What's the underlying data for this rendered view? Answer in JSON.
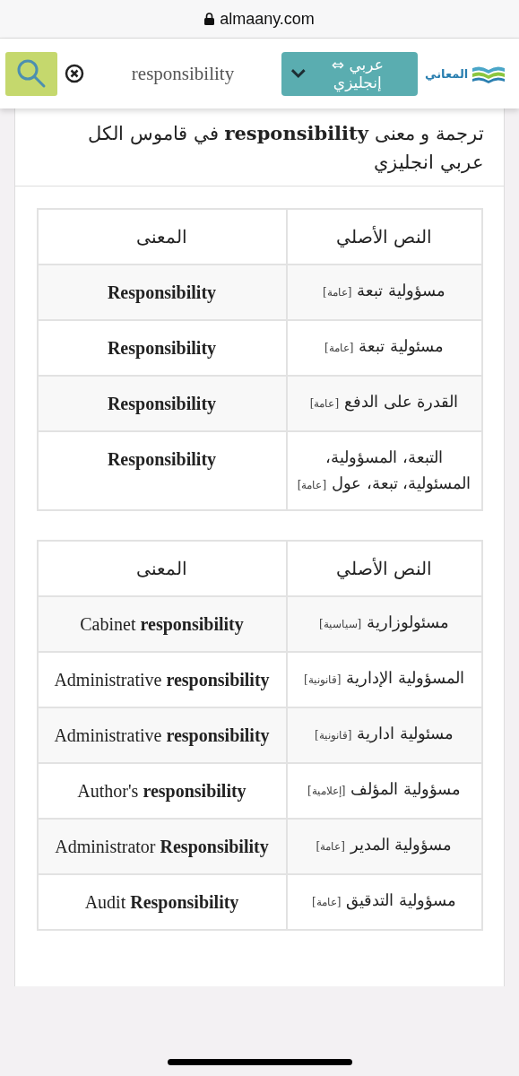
{
  "browser": {
    "url": "almaany.com"
  },
  "header": {
    "search_query": "responsibility",
    "language": "عربي ⇔ إنجليزي",
    "logo": "المعاني"
  },
  "title": "ترجمة و معنى **responsibility** في قاموس الكل عربي انجليزي",
  "tables": [
    {
      "columns": [
        "النص الأصلي",
        "المعنى"
      ],
      "rows": [
        {
          "original": "مسؤولية تبعة",
          "tag": "[عامة]",
          "meaning": "Responsibility",
          "bold": true
        },
        {
          "original": "مسئولية تبعة",
          "tag": "[عامة]",
          "meaning": "Responsibility",
          "bold": true
        },
        {
          "original": "القدرة على الدفع",
          "tag": "[عامة]",
          "meaning": "Responsibility",
          "bold": true
        },
        {
          "original": "التبعة، المسؤولية، المسئولية، تبعة، عول",
          "tag": "[عامة]",
          "meaning": "Responsibility",
          "bold": true
        }
      ]
    },
    {
      "columns": [
        "النص الأصلي",
        "المعنى"
      ],
      "rows": [
        {
          "original": "مسئولوزارية",
          "tag": "[سياسية]",
          "meaning": "Cabinet **responsibility**",
          "bold": false
        },
        {
          "original": "المسؤولية الإدارية",
          "tag": "[قانونية]",
          "meaning": "Administrative **responsibility**",
          "bold": false
        },
        {
          "original": "مسئولية ادارية",
          "tag": "[قانونية]",
          "meaning": "Administrative **responsibility**",
          "bold": false
        },
        {
          "original": "مسؤولية المؤلف",
          "tag": "[إعلامية]",
          "meaning": "Author's **responsibility**",
          "bold": false
        },
        {
          "original": "مسؤولية المدير",
          "tag": "[عامة]",
          "meaning": "Administrator **Responsibility**",
          "bold": false
        },
        {
          "original": "مسؤولية التدقيق",
          "tag": "[عامة]",
          "meaning": "Audit **Responsibility**",
          "bold": false
        }
      ]
    }
  ]
}
